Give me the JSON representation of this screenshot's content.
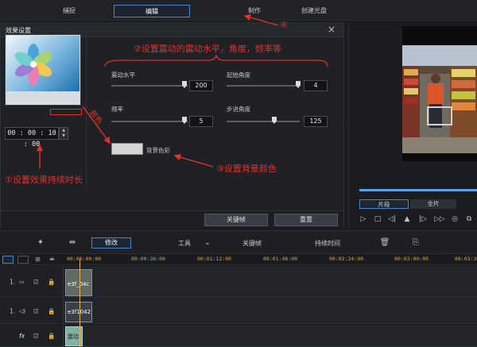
{
  "top_tabs": [
    "捕捉",
    "编辑",
    "制作",
    "创建光盘"
  ],
  "dialog": {
    "title": "效果设置",
    "close": "×",
    "duration": "00 : 00 : 10 : 00",
    "params": {
      "shake_level_label": "震动水平",
      "shake_level_value": "200",
      "start_angle_label": "起始角度",
      "start_angle_value": "4",
      "frequency_label": "频率",
      "frequency_value": "5",
      "step_angle_label": "步进角度",
      "step_angle_value": "125",
      "bg_color_label": "背景色彩"
    },
    "buttons": {
      "keyframe": "关键帧",
      "reset": "重置"
    }
  },
  "player": {
    "tabs": [
      "片段",
      "全片"
    ]
  },
  "timeline_toolbar": {
    "modify": "修改",
    "tools": "工具",
    "keyframe": "关键帧",
    "duration": "持续时间"
  },
  "ruler_ticks": [
    "00:00:00:00",
    "00:00:36:00",
    "00:01:12:00",
    "00:01:48:00",
    "00:02:24:00",
    "00:03:00:00",
    "00:03:36:00"
  ],
  "tracks": {
    "video_label": "1.",
    "audio_label": "1.",
    "video_clip": "e3f_04c",
    "audio_clip": "e3f1042",
    "fx_label": "fx",
    "fx_clip": "震动"
  },
  "annotations": {
    "a1": "①设置效果持续时长",
    "a2": "②设置震动的震动水平，角度，频率等",
    "a3": "③设置背景颜色",
    "a4": "④",
    "color_word": "颜色"
  },
  "colors": {
    "accent": "#4a86c5",
    "annotation": "#e0322c",
    "timecode": "#d9a33a"
  }
}
